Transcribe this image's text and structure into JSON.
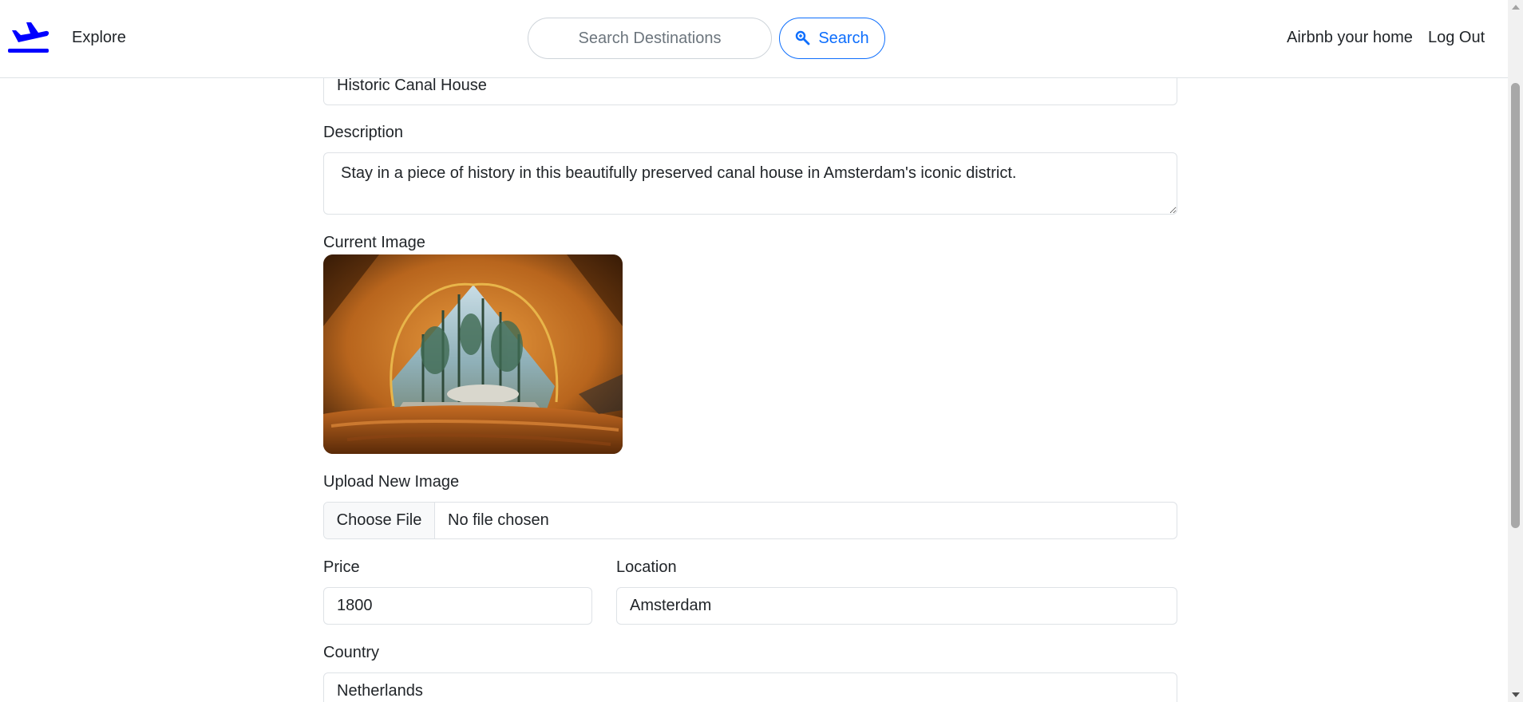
{
  "navbar": {
    "brand_icon": "airplane-departure-icon",
    "explore_label": "Explore",
    "search_placeholder": "Search Destinations",
    "search_button_label": "Search",
    "search_icon": "magnifier-icon",
    "host_label": "Airbnb your home",
    "logout_label": "Log Out"
  },
  "form": {
    "title_value": "Historic Canal House",
    "description_label": "Description",
    "description_value": "Stay in a piece of history in this beautifully preserved canal house in Amsterdam's iconic district.",
    "current_image_label": "Current Image",
    "current_image_alt": "View from inside an orange tent looking out at a pine forest",
    "upload_label": "Upload New Image",
    "choose_file_label": "Choose File",
    "file_status": "No file chosen",
    "price_label": "Price",
    "price_value": "1800",
    "location_label": "Location",
    "location_value": "Amsterdam",
    "country_label": "Country",
    "country_value": "Netherlands"
  },
  "colors": {
    "accent": "#0d6efd",
    "brand": "#0000ff",
    "border": "#dee2e6",
    "text": "#212529"
  }
}
